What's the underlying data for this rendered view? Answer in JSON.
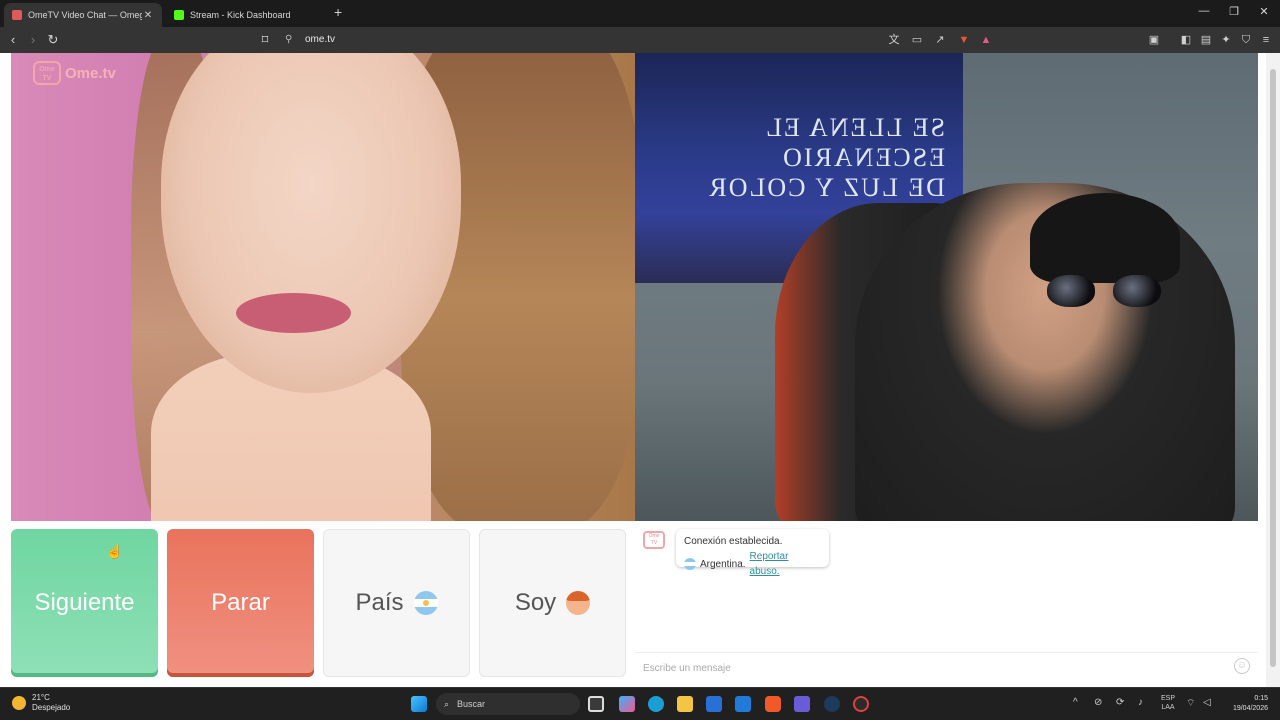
{
  "browser": {
    "tabs": [
      {
        "label": "OmeTV Video Chat — Omeg",
        "close": "✕",
        "favicon_color": "#e05a5a"
      },
      {
        "label": "Stream - Kick Dashboard",
        "favicon_color": "#53fc18"
      }
    ],
    "new_tab": "+",
    "window_controls": {
      "minimize": "—",
      "maximize": "❐",
      "close": "✕"
    },
    "url": "ome.tv"
  },
  "site": {
    "logo_badge": "Ome TV",
    "logo_text": "Ome.tv",
    "brand_color": "#f2a6a8"
  },
  "controls": {
    "next_label": "Siguiente",
    "stop_label": "Parar",
    "country_label": "País",
    "gender_label": "Soy",
    "next_color": "#6fd6a1",
    "stop_color": "#e9735c"
  },
  "chat": {
    "system_logo": "Ome TV",
    "status": "Conexión establecida.",
    "country": "Argentina.",
    "report_link": "Reportar abuso.",
    "placeholder": "Escribe un mensaje",
    "emoji_icon": "☺"
  },
  "taskbar": {
    "weather_temp": "21°C",
    "weather_desc": "Despejado",
    "search_label": "Buscar",
    "language_top": "ESP",
    "language_bottom": "LAA",
    "time": "0:15",
    "date": "19/04/2026"
  }
}
